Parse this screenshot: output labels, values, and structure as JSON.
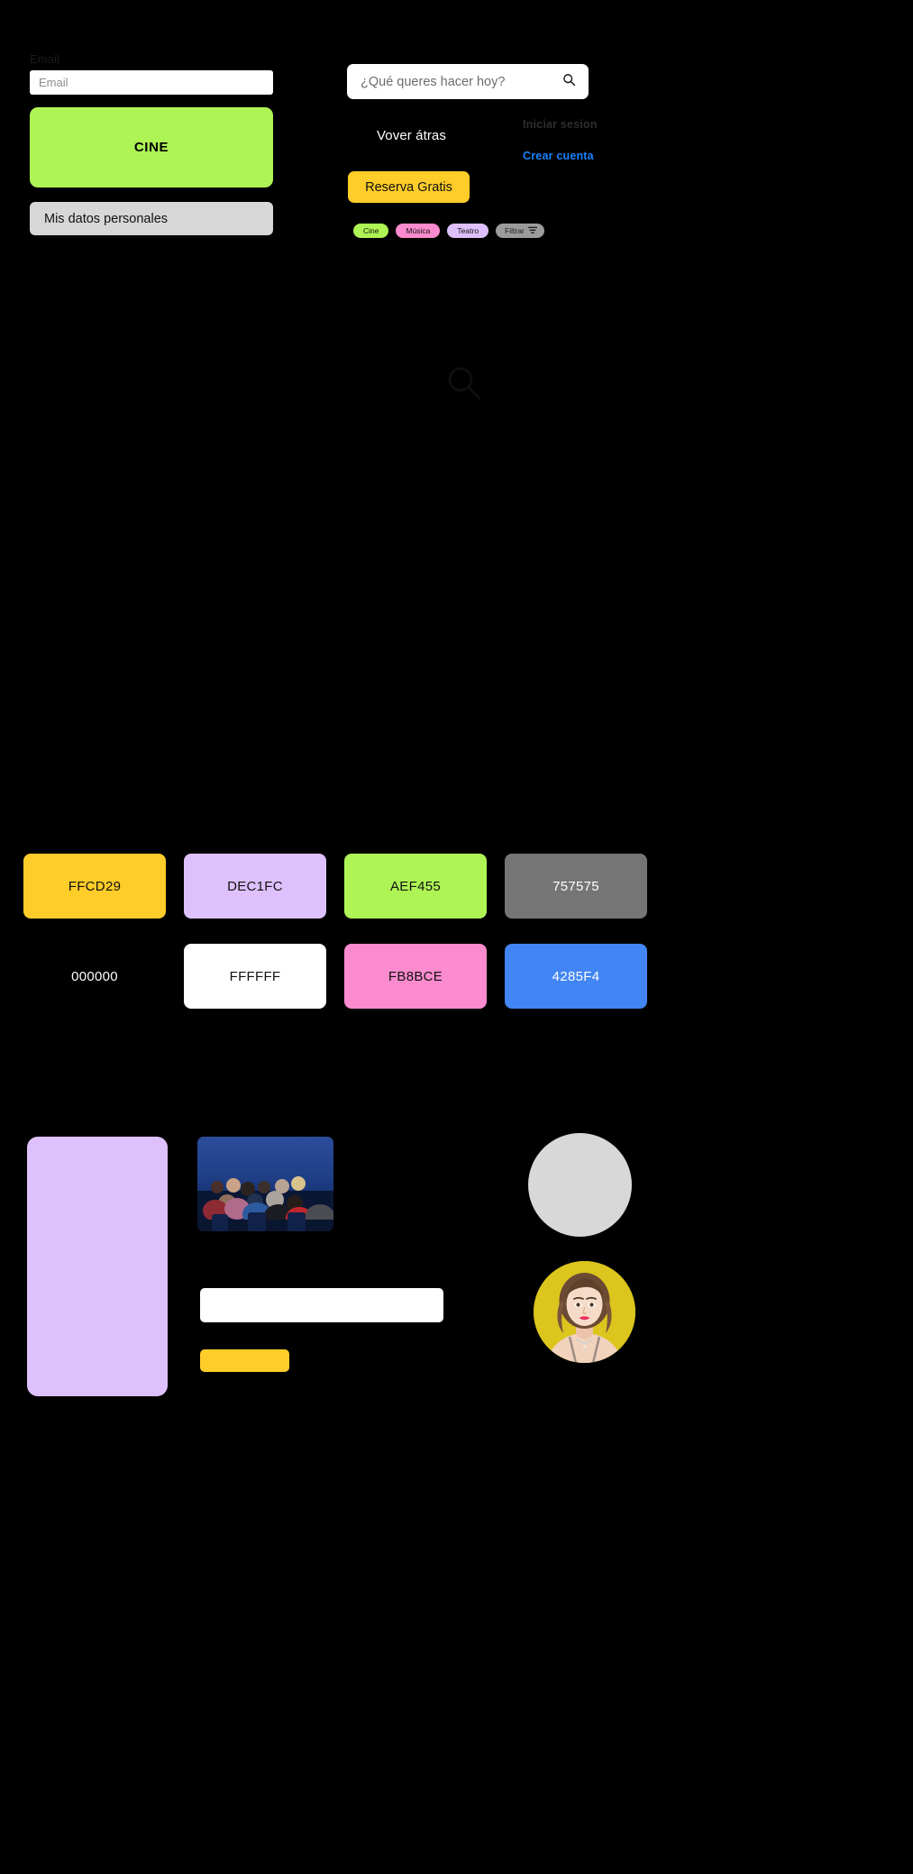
{
  "form": {
    "email_label": "Email",
    "email_placeholder": "Email",
    "email_value": "",
    "cine_button_label": "CINE",
    "personal_data_label": "Mis datos personales"
  },
  "search": {
    "placeholder": "¿Qué queres hacer hoy?",
    "value": "",
    "icon": "search-icon"
  },
  "header": {
    "back_label": "Vover átras",
    "login_label": "Iniciar sesion",
    "create_account_label": "Crear cuenta",
    "reserve_label": "Reserva Gratis"
  },
  "chips": [
    {
      "label": "Cine",
      "color": "#AEF455",
      "icon": ""
    },
    {
      "label": "Música",
      "color": "#FB8BCE",
      "icon": ""
    },
    {
      "label": "Teatro",
      "color": "#DEC1FC",
      "icon": ""
    },
    {
      "label": "Filtrar",
      "color": "#9B9B9B",
      "icon": "filter-icon"
    }
  ],
  "ghost_icon": {
    "name": "search-icon"
  },
  "palette": {
    "row1": [
      {
        "hex": "FFCD29",
        "bg": "#FFCD29",
        "text": "#111111"
      },
      {
        "hex": "DEC1FC",
        "bg": "#DEC1FC",
        "text": "#111111"
      },
      {
        "hex": "AEF455",
        "bg": "#AEF455",
        "text": "#111111"
      },
      {
        "hex": "757575",
        "bg": "#757575",
        "text": "#ffffff"
      }
    ],
    "row2": [
      {
        "hex": "000000",
        "bg": "#000000",
        "text": "#ffffff"
      },
      {
        "hex": "FFFFFF",
        "bg": "#FFFFFF",
        "text": "#111111"
      },
      {
        "hex": "FB8BCE",
        "bg": "#FB8BCE",
        "text": "#111111"
      },
      {
        "hex": "4285F4",
        "bg": "#4285F4",
        "text": "#ffffff"
      }
    ]
  },
  "assets": {
    "lilac_panel": {
      "name": "lilac-placeholder-panel",
      "color": "#DEC1FC"
    },
    "cinema_photo": {
      "name": "cinema-audience-photo"
    },
    "white_bar": {
      "name": "white-input-placeholder",
      "color": "#FFFFFF"
    },
    "yellow_bar": {
      "name": "yellow-button-placeholder",
      "color": "#FFCD29"
    },
    "gray_circle": {
      "name": "gray-avatar-placeholder",
      "color": "#D8D8D8"
    },
    "avatar_photo": {
      "name": "user-avatar-photo"
    }
  }
}
